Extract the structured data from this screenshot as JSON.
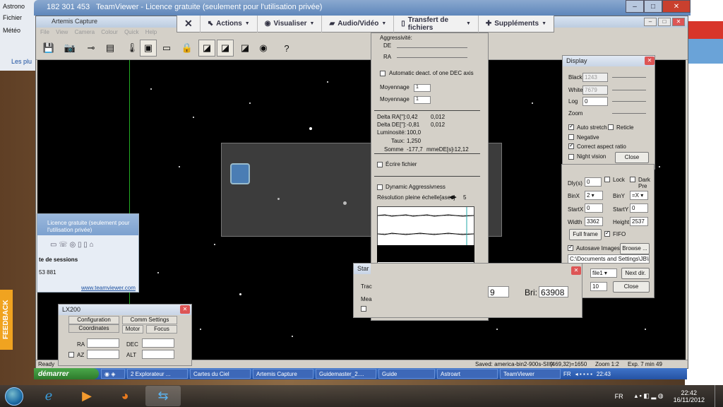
{
  "background": {
    "left_items": [
      "Astrono",
      "Fichier",
      "Météo",
      "Les plu"
    ]
  },
  "teamviewer": {
    "id": "182 301 453",
    "title": "TeamViewer - Licence gratuite (seulement pour l'utilisation privée)",
    "toolbar": [
      {
        "label": "Actions",
        "icon": "cursor-icon"
      },
      {
        "label": "Visualiser",
        "icon": "eye-icon"
      },
      {
        "label": "Audio/Vidéo",
        "icon": "video-icon"
      },
      {
        "label": "Transfert de fichiers",
        "icon": "file-icon"
      },
      {
        "label": "Suppléments",
        "icon": "puzzle-icon"
      }
    ],
    "close_symbol": "✕"
  },
  "artemis": {
    "title": "Artemis Capture",
    "menu": [
      "File",
      "View",
      "Camera",
      "Colour",
      "Quick",
      "Help"
    ],
    "status": {
      "ready": "Ready",
      "saved": "Saved: america-bin2-900s-SII9.",
      "coords": "(469,32)=1650",
      "zoom": "Zoom 1:2",
      "exp": "Exp. 7 min 49"
    }
  },
  "guide": {
    "aggressivite": "Aggressivité:",
    "de": "DE",
    "ra": "RA",
    "auto_deact": "Automatic deact. of one DEC axis",
    "moyennage1": "Moyennage",
    "moyennage1_val": "1",
    "moyennage2": "Moyennage",
    "moyennage2_val": "1",
    "delta_ra_label": "Delta RA[\"]:",
    "delta_ra_1": "0,42",
    "delta_ra_2": "0,012",
    "delta_de_label": "Delta DE[\"]:",
    "delta_de_1": "-0,81",
    "delta_de_2": "0,012",
    "lum_label": "Luminosité:",
    "lum_val": "100,0",
    "taux_label": "Taux:",
    "taux_val": "1,250",
    "somme": "Somme",
    "somme_val": "-177,7",
    "somme_de": "mmeDE[s]:",
    "somme_de_val": "-12,12",
    "ecrire": "Écrire fichier",
    "dynamic": "Dynamic Aggressivness",
    "resolution": "Résolution pleine échelle[asec]",
    "resolution_val": "5"
  },
  "display": {
    "title": "Display",
    "black": "Black",
    "black_val": "1243",
    "white": "White",
    "white_val": "7679",
    "log": "Log",
    "log_val": "0",
    "zoom": "Zoom",
    "auto_stretch": "Auto stretch",
    "reticle": "Reticle",
    "negative": "Negative",
    "correct_aspect": "Correct aspect ratio",
    "night_vision": "Night vision",
    "close": "Close"
  },
  "camera": {
    "dly": "Dly(s)",
    "dly_val": "0",
    "lock": "Lock",
    "dark": "Dark",
    "pre": "Pre",
    "binx": "BinX",
    "binx_val": "2",
    "biny": "BinY",
    "biny_val": "=X",
    "startx": "StartX",
    "startx_val": "0",
    "starty": "StartY",
    "starty_val": "0",
    "width": "Width",
    "width_val": "3362",
    "height": "Height",
    "height_val": "2537",
    "full_frame": "Full frame",
    "fifo": "FIFO",
    "autosave": "Autosave Images",
    "browse": "Browse ...",
    "path": "C:\\Documents and Settings\\JB\\M",
    "file_val": "file1",
    "next_dir": "Next dir.",
    "num_val": "10",
    "close": "Close"
  },
  "stat": {
    "title": "Star",
    "tra": "Trac",
    "mea": "Mea",
    "val1": "9",
    "bri_label": "Bri:",
    "bri_val": "63908"
  },
  "lx200": {
    "title": "LX200",
    "tabs_top": [
      "Configuration",
      "Comm Settings"
    ],
    "tabs_bottom": [
      "Coordinates",
      "Motor",
      "Focus"
    ],
    "ra": "RA",
    "dec": "DEC",
    "az": "AZ",
    "alt": "ALT"
  },
  "tv_notice": {
    "line1": "Licence gratuite (seulement pour",
    "line2": "l'utilisation privée)",
    "sessions": "te de sessions",
    "count": "53 881",
    "link": "www.teamviewer.com"
  },
  "feedback": "FEEDBACK",
  "taskbar_remote": {
    "start": "démarrer",
    "items": [
      "2 Explorateur ...",
      "Cartes du Ciel",
      "Artemis Capture",
      "Guidemaster_2....",
      "Guide",
      "Astroart",
      "TeamViewer"
    ],
    "lang": "FR",
    "time": "22:43"
  },
  "taskbar_local": {
    "lang": "FR",
    "time": "22:42",
    "date": "16/11/2012"
  }
}
